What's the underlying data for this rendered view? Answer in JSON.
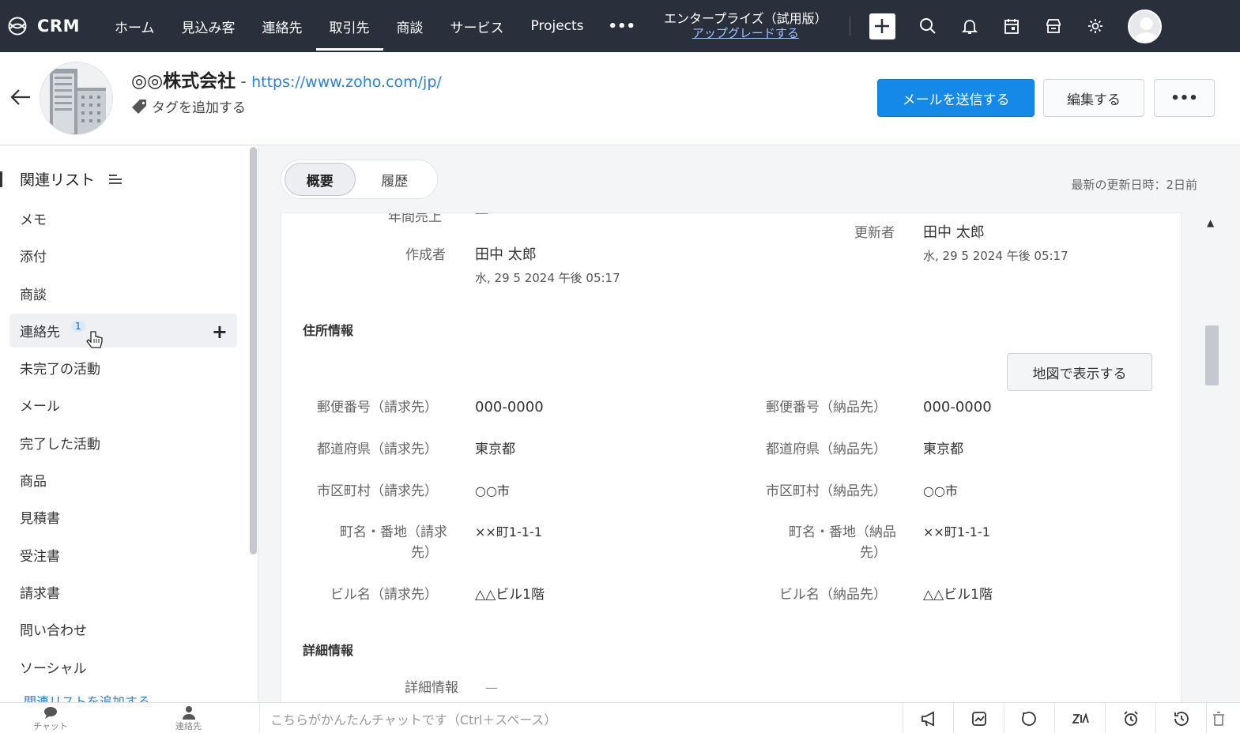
{
  "app": {
    "name": "CRM"
  },
  "nav": {
    "tabs": [
      {
        "label": "ホーム",
        "active": false
      },
      {
        "label": "見込み客",
        "active": false
      },
      {
        "label": "連絡先",
        "active": false
      },
      {
        "label": "取引先",
        "active": true
      },
      {
        "label": "商談",
        "active": false
      },
      {
        "label": "サービス",
        "active": false
      },
      {
        "label": "Projects",
        "active": false
      }
    ],
    "more": "•••",
    "edition_title": "エンタープライズ（試用版）",
    "edition_link": "アップグレードする",
    "icons": [
      "plus-icon",
      "search-icon",
      "bell-icon",
      "calendar-icon",
      "store-icon",
      "gear-icon",
      "avatar"
    ]
  },
  "record": {
    "name": "◎◎株式会社",
    "separator": " - ",
    "url": "https://www.zoho.com/jp/",
    "tag_add": "タグを追加する",
    "send_mail": "メールを送信する",
    "edit": "編集する",
    "more": "•••"
  },
  "sidebar": {
    "title": "関連リスト",
    "items": [
      {
        "label": "メモ"
      },
      {
        "label": "添付"
      },
      {
        "label": "商談"
      },
      {
        "label": "連絡先",
        "count": "1",
        "hover": true
      },
      {
        "label": "未完了の活動"
      },
      {
        "label": "メール"
      },
      {
        "label": "完了した活動"
      },
      {
        "label": "商品"
      },
      {
        "label": "見積書"
      },
      {
        "label": "受注書"
      },
      {
        "label": "請求書"
      },
      {
        "label": "問い合わせ"
      },
      {
        "label": "ソーシャル"
      }
    ],
    "add_plus": "+",
    "footer_link": "関連リストを追加する"
  },
  "main": {
    "tabs": {
      "overview": "概要",
      "history": "履歴"
    },
    "last_updated": "最新の更新日時：2日前",
    "cut_label": "年間売上",
    "cut_value": "—",
    "created_by_label": "作成者",
    "created_by": "田中 太郎",
    "created_at": "水, 29 5 2024 午後 05:17",
    "modified_by_label": "更新者",
    "modified_by": "田中 太郎",
    "modified_at": "水, 29 5 2024 午後 05:17",
    "address_section": "住所情報",
    "map_button": "地図で表示する",
    "billing": {
      "zip_label": "郵便番号（請求先）",
      "zip": "000-0000",
      "pref_label": "都道府県（請求先）",
      "pref": "東京都",
      "city_label": "市区町村（請求先）",
      "city": "○○市",
      "street_label_1": "町名・番地（請求",
      "street_label_2": "先）",
      "street": "××町1-1-1",
      "building_label": "ビル名（請求先）",
      "building": "△△ビル1階"
    },
    "shipping": {
      "zip_label": "郵便番号（納品先）",
      "zip": "000-0000",
      "pref_label": "都道府県（納品先）",
      "pref": "東京都",
      "city_label": "市区町村（納品先）",
      "city": "○○市",
      "street_label_1": "町名・番地（納品",
      "street_label_2": "先）",
      "street": "××町1-1-1",
      "building_label": "ビル名（納品先）",
      "building": "△△ビル1階"
    },
    "detail_section": "詳細情報",
    "detail_label": "詳細情報",
    "detail_value": "—"
  },
  "bottom": {
    "chat": "チャット",
    "contacts": "連絡先",
    "chat_placeholder": "こちらがかんたんチャットです（Ctrl＋スペース）",
    "tools": [
      "megaphone-icon",
      "chart-icon",
      "refresh-icon",
      "zia-icon",
      "alarm-icon",
      "history-icon",
      "bin-icon"
    ]
  },
  "colors": {
    "nav_bg": "#2a2f3c",
    "primary": "#1589e8",
    "link": "#2f80d8"
  }
}
